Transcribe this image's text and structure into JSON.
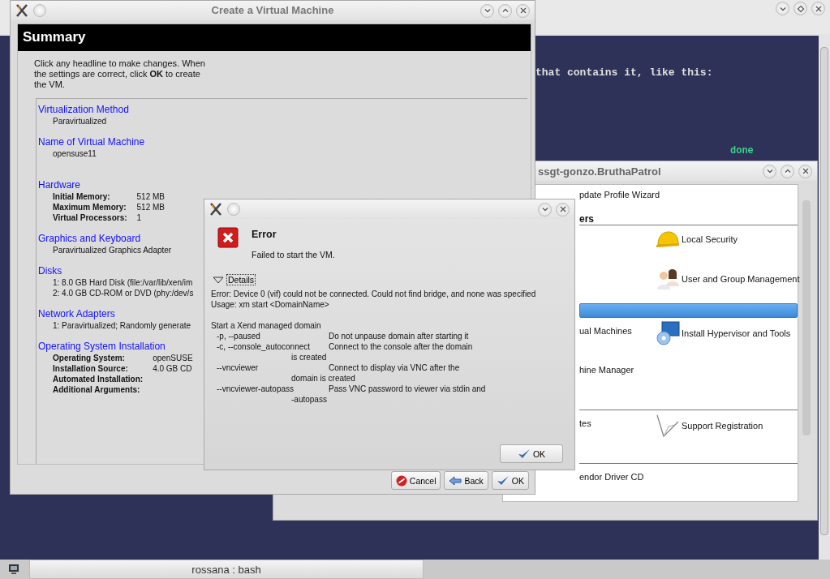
{
  "terminal": {
    "lines": [
      {
        "kind": "output",
        "text": "that contains it, like this:"
      },
      {
        "kind": "status",
        "text": "done"
      }
    ]
  },
  "yast": {
    "title": "ssgt-gonzo.BruthaPatrol",
    "rows": [
      {
        "kind": "item",
        "left": "pdate Profile Wizard"
      },
      {
        "kind": "header",
        "text": "ers",
        "selected": false
      },
      {
        "kind": "item",
        "right": "Local Security"
      },
      {
        "kind": "item",
        "right": "User and Group Management"
      },
      {
        "kind": "header",
        "selected": true
      },
      {
        "kind": "item",
        "left": "ual Machines",
        "right": "Install Hypervisor and Tools"
      },
      {
        "kind": "item",
        "left": "hine Manager"
      },
      {
        "kind": "header",
        "selected": false
      },
      {
        "kind": "item",
        "left": "tes",
        "right": "Support Registration"
      },
      {
        "kind": "header",
        "selected": false
      },
      {
        "kind": "item",
        "left": "endor Driver CD"
      }
    ]
  },
  "wizard": {
    "title": "Create a Virtual Machine",
    "heading": "Summary",
    "intro": "Click any headline to make changes.  When the settings are correct, click **OK** to create the VM.",
    "sections": [
      {
        "headline": "Virtualization Method",
        "lines": [
          {
            "kind": "text",
            "text": "Paravirtualized"
          }
        ]
      },
      {
        "headline": "Name of Virtual Machine",
        "lines": [
          {
            "kind": "text",
            "text": "opensuse11"
          }
        ]
      },
      {
        "headline": "Hardware",
        "lines": [
          {
            "kind": "field",
            "label": "Initial Memory:",
            "value": "512 MB"
          },
          {
            "kind": "field",
            "label": "Maximum Memory:",
            "value": "512 MB"
          },
          {
            "kind": "field",
            "label": "Virtual Processors:",
            "value": "1"
          }
        ]
      },
      {
        "headline": "Graphics and Keyboard",
        "lines": [
          {
            "kind": "text",
            "text": "Paravirtualized Graphics Adapter"
          }
        ]
      },
      {
        "headline": "Disks",
        "lines": [
          {
            "kind": "text",
            "text": "1: 8.0 GB Hard Disk (file:/var/lib/xen/im"
          },
          {
            "kind": "text",
            "text": "2: 4.0 GB CD-ROM or DVD (phy:/dev/s"
          }
        ]
      },
      {
        "headline": "Network Adapters",
        "lines": [
          {
            "kind": "text",
            "text": "1: Paravirtualized; Randomly generate"
          }
        ]
      },
      {
        "headline": "Operating System Installation",
        "lines": [
          {
            "kind": "field",
            "label": "Operating System:",
            "value": "openSUSE"
          },
          {
            "kind": "field",
            "label": "Installation Source:",
            "value": "4.0 GB CD"
          },
          {
            "kind": "field",
            "label": "Automated Installation:"
          },
          {
            "kind": "field",
            "label": "Additional Arguments:"
          }
        ]
      }
    ],
    "buttons": [
      {
        "kind": "cancel",
        "label": "Cancel"
      },
      {
        "kind": "back",
        "label": "Back"
      },
      {
        "kind": "ok",
        "label": "OK"
      }
    ]
  },
  "error_dialog": {
    "heading": "Error",
    "message": "Failed to start the VM.",
    "details_label": "Details",
    "details_expanded": true,
    "error_lines": [
      "Error: Device 0 (vif) could not be connected. Could not find bridge, and none was specified",
      "Usage: xm start <DomainName>"
    ],
    "summary": "Start a Xend managed domain",
    "options": [
      {
        "flag": "-p, --paused",
        "description": "Do not unpause domain after starting it"
      },
      {
        "flag": "-c, --console_autoconnect",
        "description": "Connect to the console after the domain",
        "continuation": "is created"
      },
      {
        "flag": "--vncviewer",
        "description": "Connect to display via VNC after the",
        "continuation": "domain is created"
      },
      {
        "flag": "--vncviewer-autopass",
        "description": "Pass VNC password to viewer via stdin and",
        "continuation": "-autopass"
      }
    ],
    "button": "OK"
  },
  "taskbar": {
    "tasks": [
      {
        "label": "rossana : bash",
        "selected": true
      }
    ]
  }
}
